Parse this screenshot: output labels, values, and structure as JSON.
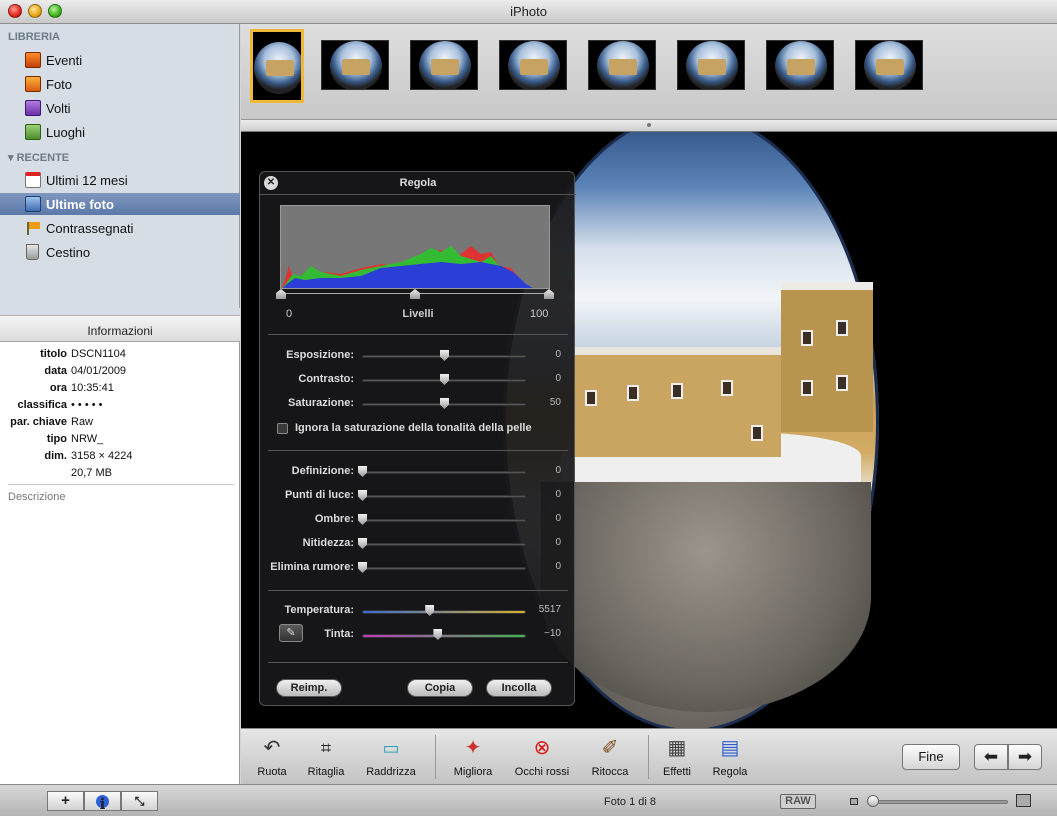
{
  "window": {
    "title": "iPhoto"
  },
  "sidebar": {
    "sections": [
      {
        "header": "LIBRERIA",
        "items": [
          {
            "label": "Eventi",
            "icon": "events-icon"
          },
          {
            "label": "Foto",
            "icon": "photos-icon"
          },
          {
            "label": "Volti",
            "icon": "faces-icon"
          },
          {
            "label": "Luoghi",
            "icon": "places-icon"
          }
        ]
      },
      {
        "header": "RECENTE",
        "items": [
          {
            "label": "Ultimi 12 mesi",
            "icon": "calendar-icon"
          },
          {
            "label": "Ultime foto",
            "icon": "last-import-icon",
            "selected": true
          },
          {
            "label": "Contrassegnati",
            "icon": "flag-icon"
          },
          {
            "label": "Cestino",
            "icon": "trash-icon"
          }
        ]
      }
    ]
  },
  "info": {
    "header": "Informazioni",
    "rows": [
      {
        "key": "titolo",
        "value": "DSCN1104"
      },
      {
        "key": "data",
        "value": "04/01/2009"
      },
      {
        "key": "ora",
        "value": "10:35:41"
      },
      {
        "key": "classifica",
        "value": "• • • • •"
      },
      {
        "key": "par. chiave",
        "value": "Raw"
      },
      {
        "key": "tipo",
        "value": "NRW_"
      },
      {
        "key": "dim.",
        "value": "3158 × 4224"
      },
      {
        "key": "",
        "value": "20,7 MB"
      }
    ],
    "description_placeholder": "Descrizione"
  },
  "filmstrip": {
    "count": 8,
    "selected_index": 0
  },
  "adjust": {
    "title": "Regola",
    "levels": {
      "min": "0",
      "label": "Livelli",
      "max": "100"
    },
    "sliders_a": [
      {
        "label": "Esposizione:",
        "value": "0",
        "pos": 0.5
      },
      {
        "label": "Contrasto:",
        "value": "0",
        "pos": 0.5
      },
      {
        "label": "Saturazione:",
        "value": "50",
        "pos": 0.5
      }
    ],
    "skin_checkbox": "Ignora la saturazione della tonalità della pelle",
    "sliders_b": [
      {
        "label": "Definizione:",
        "value": "0",
        "pos": 0
      },
      {
        "label": "Punti di luce:",
        "value": "0",
        "pos": 0
      },
      {
        "label": "Ombre:",
        "value": "0",
        "pos": 0
      },
      {
        "label": "Nitidezza:",
        "value": "0",
        "pos": 0
      },
      {
        "label": "Elimina rumore:",
        "value": "0",
        "pos": 0
      }
    ],
    "sliders_c": [
      {
        "label": "Temperatura:",
        "value": "5517",
        "pos": 0.41
      },
      {
        "label": "Tinta:",
        "value": "−10",
        "pos": 0.46
      }
    ],
    "buttons": {
      "reset": "Reimp.",
      "copy": "Copia",
      "paste": "Incolla"
    }
  },
  "toolbar": {
    "tools": [
      {
        "label": "Ruota",
        "icon": "rotate-icon"
      },
      {
        "label": "Ritaglia",
        "icon": "crop-icon"
      },
      {
        "label": "Raddrizza",
        "icon": "straighten-icon"
      },
      {
        "label": "Migliora",
        "icon": "enhance-icon"
      },
      {
        "label": "Occhi rossi",
        "icon": "red-eye-icon"
      },
      {
        "label": "Ritocca",
        "icon": "retouch-icon"
      },
      {
        "label": "Effetti",
        "icon": "effects-icon"
      },
      {
        "label": "Regola",
        "icon": "adjust-icon"
      }
    ],
    "done_label": "Fine"
  },
  "status": {
    "photo_count": "Foto 1 di 8",
    "raw_badge": "RAW",
    "zoom_level": 0.0
  }
}
